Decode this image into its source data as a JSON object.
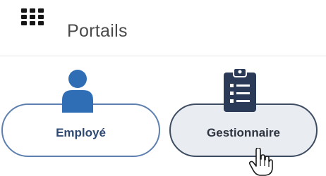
{
  "header": {
    "grid_icon": "apps-grid-icon",
    "title": "Portails"
  },
  "portals": [
    {
      "label": "Employé",
      "icon": "person-icon",
      "color": "#2f6db5"
    },
    {
      "label": "Gestionnaire",
      "icon": "clipboard-list-icon",
      "color": "#2b3b57",
      "state": "hovered"
    }
  ],
  "cursor": {
    "icon": "hand-pointer-icon"
  }
}
